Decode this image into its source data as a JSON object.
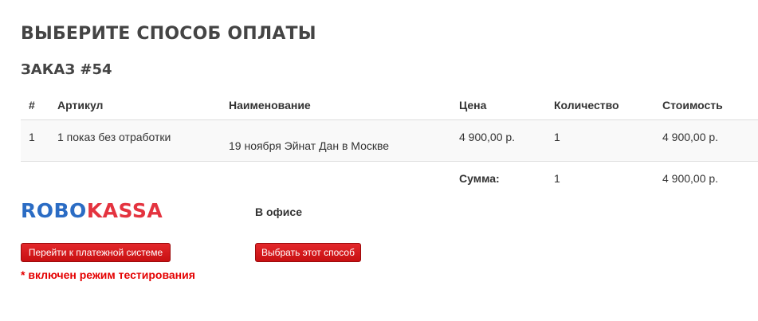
{
  "page": {
    "title": "ВЫБЕРИТЕ СПОСОБ ОПЛАТЫ",
    "order_heading": "ЗАКАЗ #54"
  },
  "table": {
    "headers": [
      "#",
      "Артикул",
      "Наименование",
      "Цена",
      "Количество",
      "Стоимость"
    ],
    "rows": [
      {
        "num": "1",
        "sku": "1 показ без отработки",
        "name": "19 ноября Эйнат Дан в Москве",
        "price": "4 900,00 р.",
        "quantity": "1",
        "total": "4 900,00 р."
      }
    ],
    "summary": {
      "label": "Сумма:",
      "quantity": "1",
      "total": "4 900,00 р."
    }
  },
  "payment": {
    "robokassa": {
      "logo_part1": "ROBO",
      "logo_part2": "KASSA",
      "button_label": "Перейти к платежной системе",
      "test_mode_notice": "* включен режим тестирования"
    },
    "office": {
      "label": "В офисе",
      "button_label": "Выбрать этот способ"
    }
  },
  "colors": {
    "button": "#d01c1f",
    "warning": "#e40000",
    "logo_blue": "#2b6cc4",
    "logo_red": "#e4333f"
  }
}
